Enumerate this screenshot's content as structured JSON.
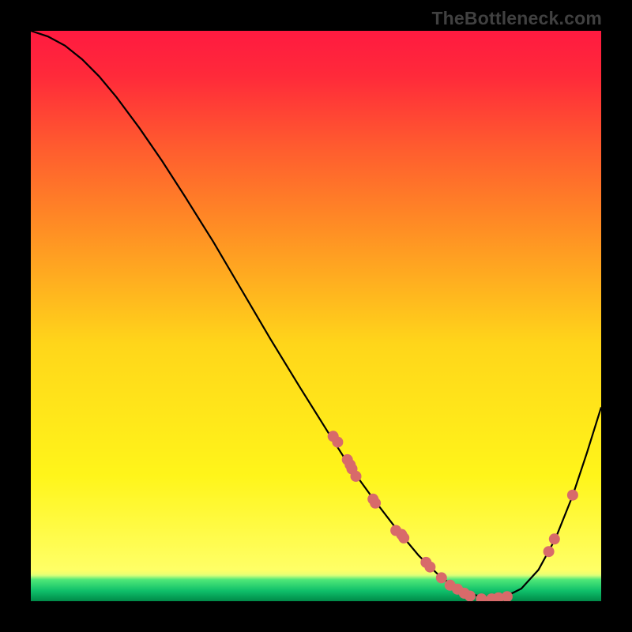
{
  "watermark": "TheBottleneck.com",
  "chart_data": {
    "type": "line",
    "title": "",
    "xlabel": "",
    "ylabel": "",
    "xlim": [
      0,
      1
    ],
    "ylim": [
      0,
      1
    ],
    "background_gradient": {
      "stops": [
        {
          "offset": 0.0,
          "color": "#ff1a40"
        },
        {
          "offset": 0.08,
          "color": "#ff2a3a"
        },
        {
          "offset": 0.2,
          "color": "#ff5a2f"
        },
        {
          "offset": 0.35,
          "color": "#ff8f24"
        },
        {
          "offset": 0.55,
          "color": "#ffd61a"
        },
        {
          "offset": 0.78,
          "color": "#fff51a"
        },
        {
          "offset": 0.945,
          "color": "#ffff66"
        },
        {
          "offset": 0.952,
          "color": "#eeff70"
        },
        {
          "offset": 0.955,
          "color": "#d4ff7a"
        },
        {
          "offset": 0.962,
          "color": "#50e878"
        },
        {
          "offset": 0.982,
          "color": "#0fbf6a"
        },
        {
          "offset": 1.0,
          "color": "#008a48"
        }
      ]
    },
    "series": [
      {
        "name": "curve",
        "color": "#000000",
        "x": [
          0.0,
          0.03,
          0.06,
          0.09,
          0.12,
          0.15,
          0.19,
          0.23,
          0.27,
          0.32,
          0.37,
          0.42,
          0.47,
          0.52,
          0.56,
          0.6,
          0.64,
          0.68,
          0.72,
          0.76,
          0.8,
          0.83,
          0.86,
          0.89,
          0.92,
          0.95,
          0.975,
          1.0
        ],
        "y": [
          1.0,
          0.99,
          0.974,
          0.95,
          0.92,
          0.884,
          0.83,
          0.772,
          0.71,
          0.63,
          0.545,
          0.46,
          0.378,
          0.298,
          0.235,
          0.18,
          0.128,
          0.08,
          0.041,
          0.016,
          0.005,
          0.007,
          0.022,
          0.055,
          0.11,
          0.185,
          0.26,
          0.34
        ]
      }
    ],
    "scatter": {
      "name": "points",
      "color": "#d86a6a",
      "r": 7,
      "points": [
        {
          "x": 0.53,
          "y": 0.289
        },
        {
          "x": 0.538,
          "y": 0.279
        },
        {
          "x": 0.555,
          "y": 0.248
        },
        {
          "x": 0.56,
          "y": 0.239
        },
        {
          "x": 0.563,
          "y": 0.232
        },
        {
          "x": 0.57,
          "y": 0.219
        },
        {
          "x": 0.6,
          "y": 0.179
        },
        {
          "x": 0.604,
          "y": 0.172
        },
        {
          "x": 0.64,
          "y": 0.124
        },
        {
          "x": 0.65,
          "y": 0.117
        },
        {
          "x": 0.654,
          "y": 0.111
        },
        {
          "x": 0.693,
          "y": 0.068
        },
        {
          "x": 0.7,
          "y": 0.06
        },
        {
          "x": 0.72,
          "y": 0.041
        },
        {
          "x": 0.735,
          "y": 0.028
        },
        {
          "x": 0.748,
          "y": 0.021
        },
        {
          "x": 0.76,
          "y": 0.014
        },
        {
          "x": 0.77,
          "y": 0.009
        },
        {
          "x": 0.79,
          "y": 0.004
        },
        {
          "x": 0.808,
          "y": 0.004
        },
        {
          "x": 0.82,
          "y": 0.006
        },
        {
          "x": 0.835,
          "y": 0.008
        },
        {
          "x": 0.908,
          "y": 0.087
        },
        {
          "x": 0.918,
          "y": 0.109
        },
        {
          "x": 0.95,
          "y": 0.186
        }
      ]
    }
  }
}
